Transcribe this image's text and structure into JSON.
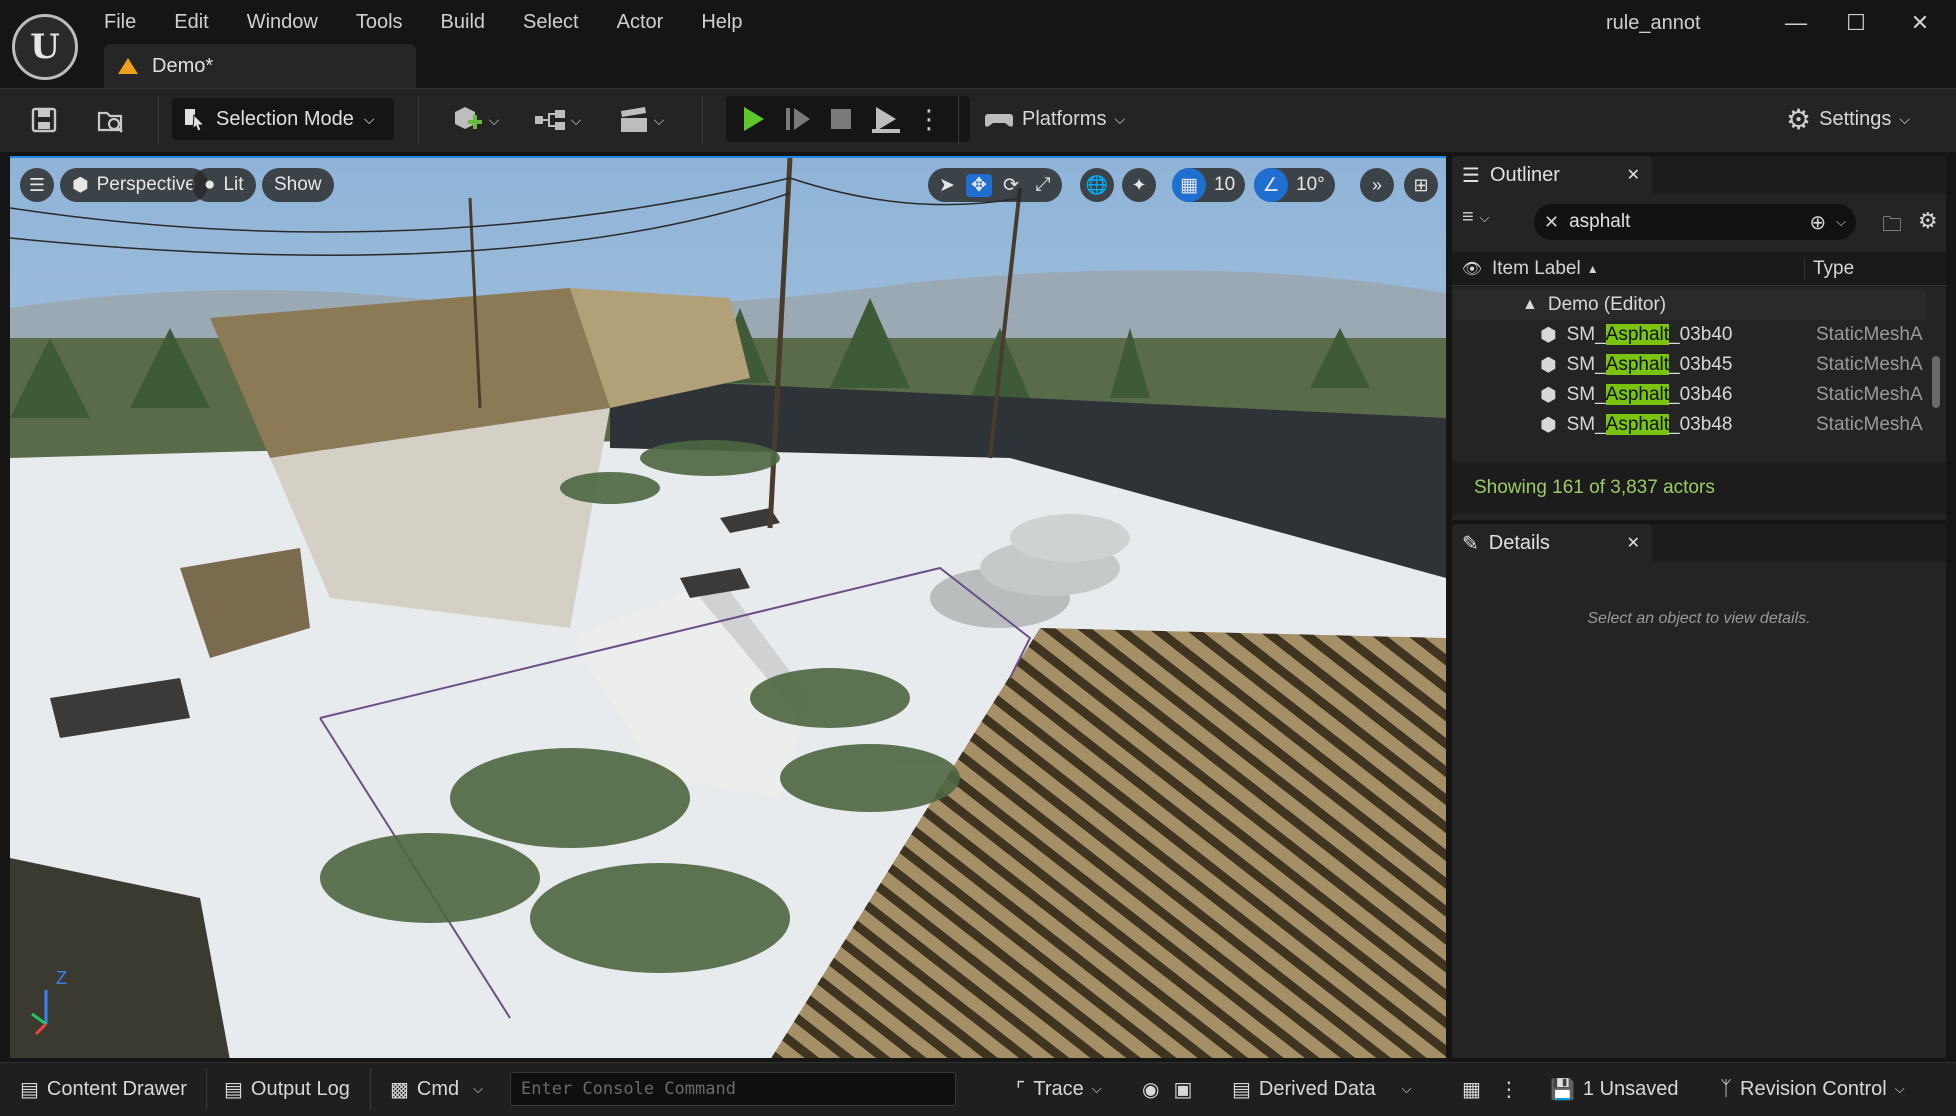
{
  "app": {
    "project_name": "rule_annot",
    "document_tab": "Demo*",
    "logo_glyph": "U"
  },
  "menu": [
    "File",
    "Edit",
    "Window",
    "Tools",
    "Build",
    "Select",
    "Actor",
    "Help"
  ],
  "window_controls": {
    "minimize": "—",
    "maximize": "☐",
    "close": "✕"
  },
  "toolbar": {
    "selection_mode": "Selection Mode",
    "platforms": "Platforms",
    "settings": "Settings"
  },
  "viewport": {
    "perspective": "Perspective",
    "lit": "Lit",
    "show": "Show",
    "grid_snap": "10",
    "angle_snap": "10°",
    "axis_label": "Z",
    "accent_color": "#1e88e5"
  },
  "outliner": {
    "title": "Outliner",
    "search_value": "asphalt",
    "col_label": "Item Label",
    "col_type": "Type",
    "root": "Demo (Editor)",
    "rows": [
      {
        "prefix": "SM_",
        "match": "Asphalt",
        "suffix": "_03b40",
        "type": "StaticMeshA"
      },
      {
        "prefix": "SM_",
        "match": "Asphalt",
        "suffix": "_03b45",
        "type": "StaticMeshA"
      },
      {
        "prefix": "SM_",
        "match": "Asphalt",
        "suffix": "_03b46",
        "type": "StaticMeshA"
      },
      {
        "prefix": "SM_",
        "match": "Asphalt",
        "suffix": "_03b48",
        "type": "StaticMeshA"
      }
    ],
    "status": "Showing 161 of 3,837 actors",
    "highlight_color": "#7ac40f",
    "status_color": "#9ccc65"
  },
  "details": {
    "title": "Details",
    "empty_text": "Select an object to view details."
  },
  "bottombar": {
    "content_drawer": "Content Drawer",
    "output_log": "Output Log",
    "cmd": "Cmd",
    "console_placeholder": "Enter Console Command",
    "trace": "Trace",
    "derived_data": "Derived Data",
    "unsaved": "1 Unsaved",
    "revision_control": "Revision Control"
  }
}
